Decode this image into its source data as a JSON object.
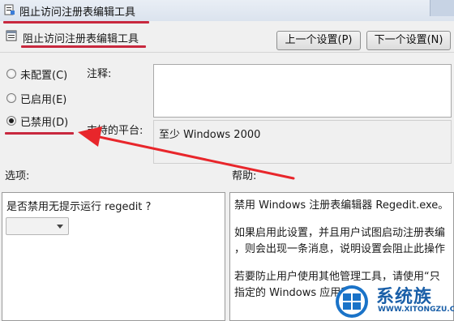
{
  "window": {
    "title": "阻止访问注册表编辑工具"
  },
  "header": {
    "setting_name": "阻止访问注册表编辑工具",
    "prev_button": "上一个设置(P)",
    "next_button": "下一个设置(N)"
  },
  "state": {
    "options": [
      {
        "label": "未配置(C)",
        "checked": false
      },
      {
        "label": "已启用(E)",
        "checked": false
      },
      {
        "label": "已禁用(D)",
        "checked": true
      }
    ]
  },
  "comment": {
    "label": "注释:",
    "value": ""
  },
  "platform": {
    "label": "支持的平台:",
    "value": "至少 Windows 2000"
  },
  "options_section": {
    "label": "选项:",
    "question": "是否禁用无提示运行 regedit ?",
    "dropdown_value": ""
  },
  "help_section": {
    "label": "帮助:",
    "lines": [
      "禁用 Windows 注册表编辑器 Regedit.exe。",
      "如果启用此设置，并且用户试图启动注册表编",
      "，则会出现一条消息，说明设置会阻止此操作",
      "若要防止用户使用其他管理工具，请使用“只",
      "指定的 Windows 应用程序"
    ]
  },
  "watermark": {
    "main": "系统族",
    "sub": "WWW.XITONGZU.COM"
  },
  "colors": {
    "annotation_red": "#c8283e",
    "watermark_blue": "#1a5fa8"
  }
}
